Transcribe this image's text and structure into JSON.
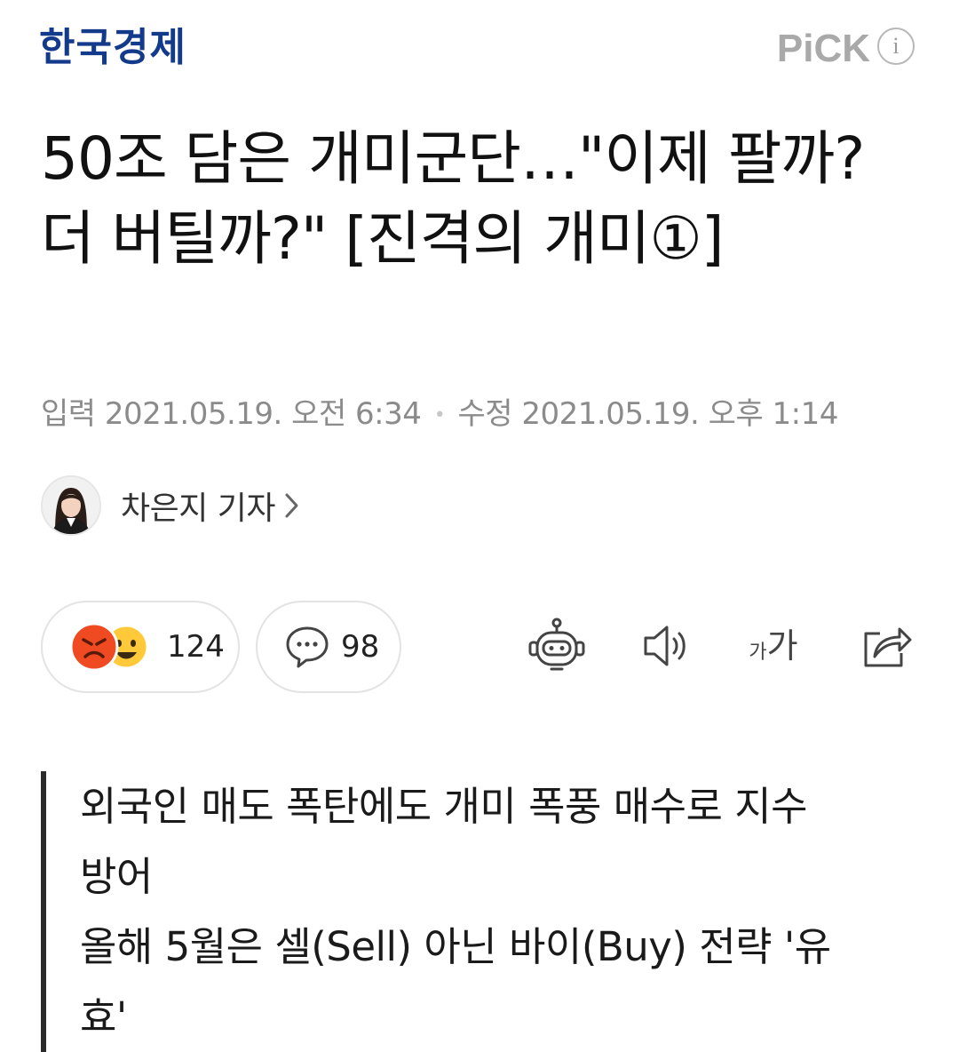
{
  "header": {
    "press_name": "한국경제",
    "pick_label": "PiCK",
    "info_label": "i"
  },
  "article": {
    "title": "50조 담은 개미군단…\"이제 팔까? 더 버틸까?\" [진격의 개미①]",
    "input_label": "입력",
    "input_datetime": "2021.05.19. 오전 6:34",
    "separator": "•",
    "modified_label": "수정",
    "modified_datetime": "2021.05.19. 오후 1:14",
    "reporter": "차은지 기자",
    "summary_lines": [
      "외국인 매도 폭탄에도 개미 폭풍 매수로 지수",
      "방어",
      "올해 5월은 셀(Sell) 아닌 바이(Buy) 전략 '유",
      "효'"
    ]
  },
  "actions": {
    "reaction_count": "124",
    "comment_count": "98",
    "font_size_label_small": "가",
    "font_size_label_large": "가"
  },
  "colors": {
    "brand": "#143a8c",
    "angry": "#f04a23",
    "smile": "#ffc93a",
    "text_gray": "#8b8b8b"
  },
  "icons": [
    "info-icon",
    "chevron-right-icon",
    "angry-face-icon",
    "laughing-face-icon",
    "comment-bubble-icon",
    "ai-robot-icon",
    "speaker-icon",
    "font-size-icon",
    "share-icon"
  ]
}
